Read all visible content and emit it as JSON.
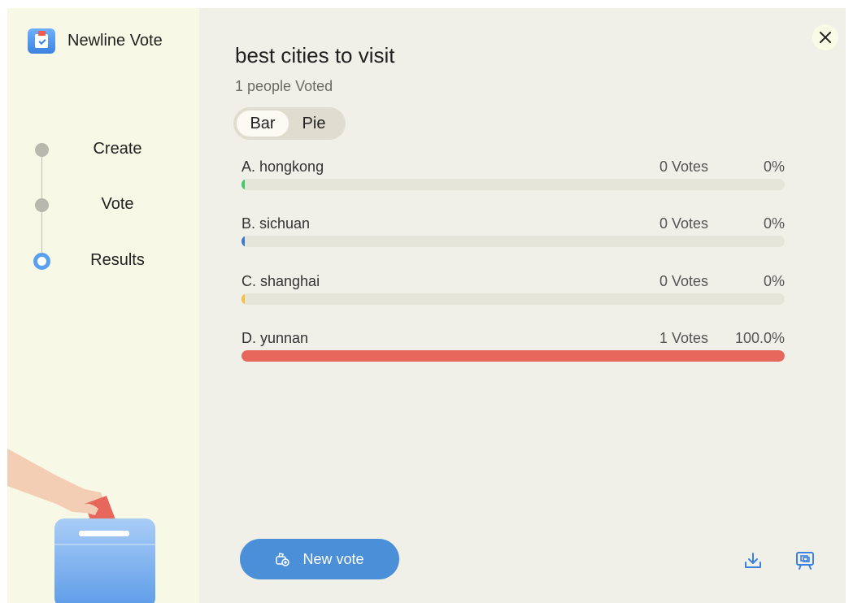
{
  "app": {
    "name": "Newline Vote"
  },
  "steps": [
    {
      "label": "Create",
      "state": "done"
    },
    {
      "label": "Vote",
      "state": "done"
    },
    {
      "label": "Results",
      "state": "active"
    }
  ],
  "poll": {
    "title": "best cities to visit",
    "voted_count": "1 people Voted"
  },
  "view_toggle": {
    "options": [
      "Bar",
      "Pie"
    ],
    "selected": "Bar"
  },
  "results": [
    {
      "name": "A. hongkong",
      "votes": "0 Votes",
      "percent": "0%",
      "fraction": 0,
      "color": "#3ecb6a"
    },
    {
      "name": "B. sichuan",
      "votes": "0 Votes",
      "percent": "0%",
      "fraction": 0,
      "color": "#3b78d8"
    },
    {
      "name": "C. shanghai",
      "votes": "0 Votes",
      "percent": "0%",
      "fraction": 0,
      "color": "#f7be3d"
    },
    {
      "name": "D. yunnan",
      "votes": "1 Votes",
      "percent": "100.0%",
      "fraction": 1,
      "color": "#e8675d"
    }
  ],
  "actions": {
    "new_vote_label": "New vote",
    "new_vote_icon": "ballot-box-add-icon",
    "download_icon": "download-icon",
    "screen_share_icon": "screen-share-icon",
    "close_icon": "close-icon"
  },
  "colors": {
    "accent": "#4b8fd8",
    "sidebar_bg": "#f7f9e6",
    "main_bg": "#f1f0e8",
    "step_active": "#5aa0f0"
  }
}
